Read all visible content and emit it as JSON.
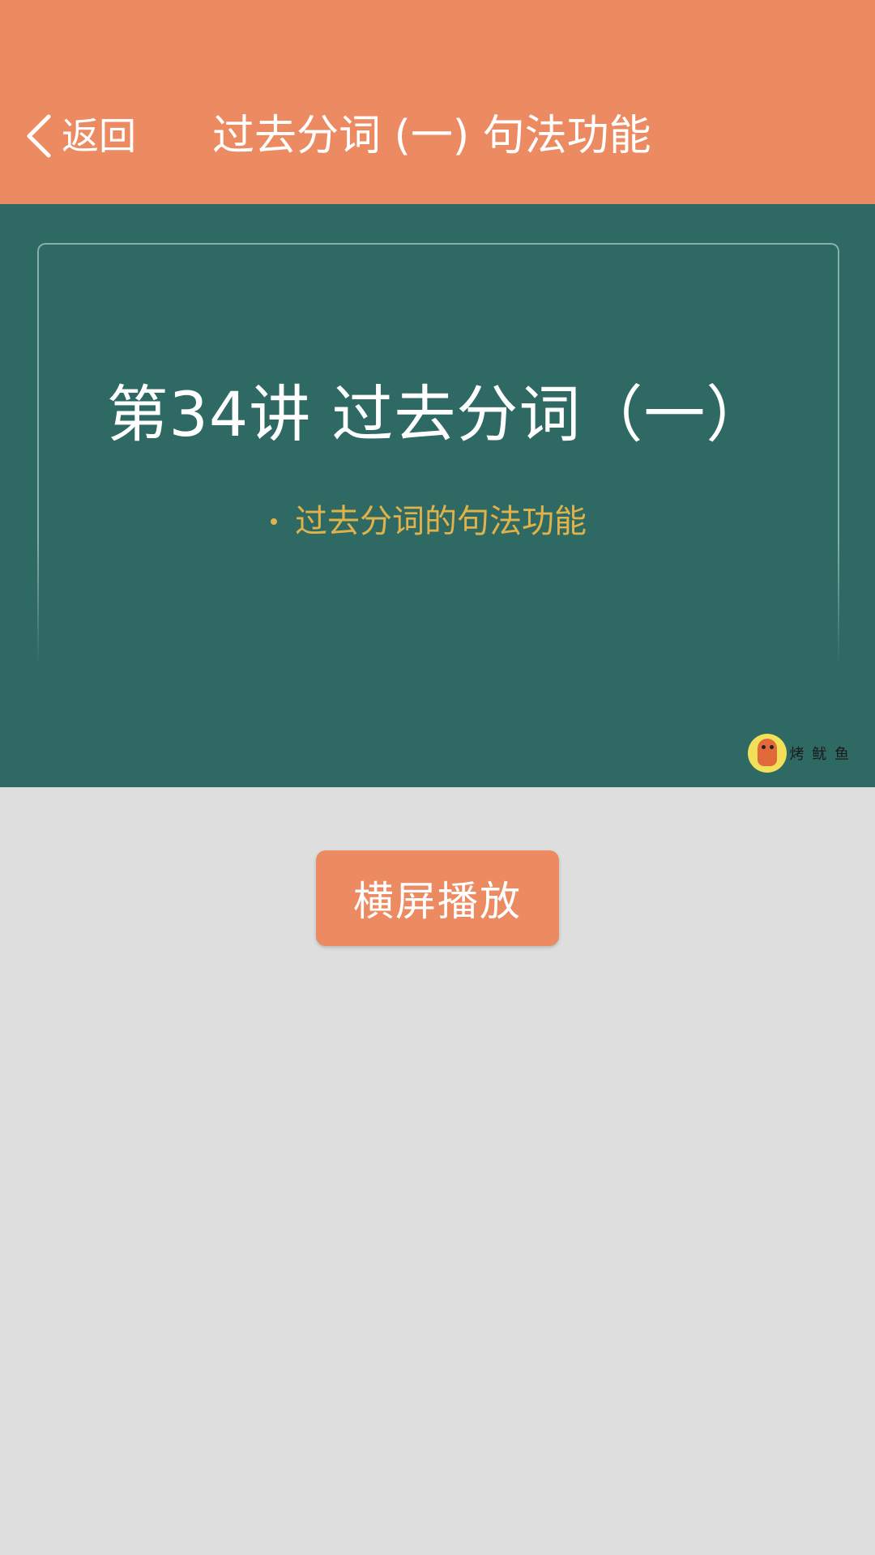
{
  "header": {
    "back_label": "返回",
    "title": "过去分词 (一) 句法功能"
  },
  "slide": {
    "title": "第34讲  过去分词（一）",
    "bullet": "过去分词的句法功能",
    "watermark_text": "烤 鱿 鱼"
  },
  "actions": {
    "landscape_label": "横屏播放"
  },
  "colors": {
    "header_bg": "#ec8a62",
    "slide_bg": "#2e6a63",
    "bullet_text": "#e0b24a",
    "page_bg": "#dedede"
  }
}
